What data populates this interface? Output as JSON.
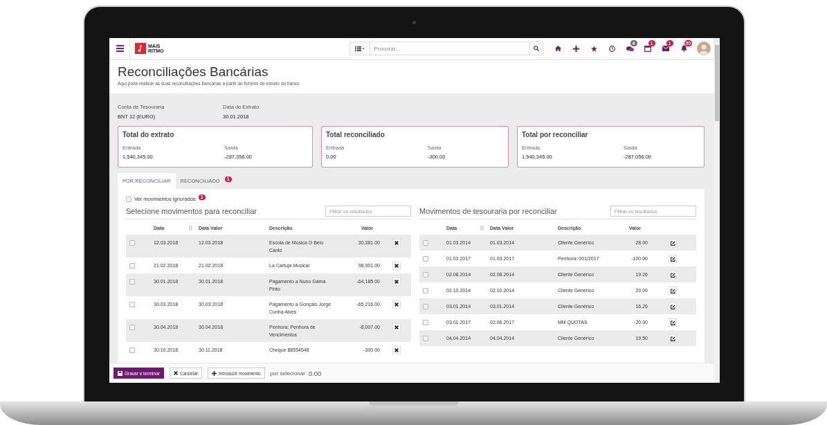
{
  "topbar": {
    "logo": {
      "line1": "MAIS",
      "line2": "RITMO"
    },
    "search": {
      "placeholder": "Procurar..."
    },
    "icons": [
      {
        "kind": "home"
      },
      {
        "kind": "plus"
      },
      {
        "kind": "star"
      },
      {
        "kind": "clock"
      },
      {
        "kind": "chat",
        "badge": "4",
        "color": "#6f6f6f"
      },
      {
        "kind": "calendar",
        "badge": "1",
        "color": "#e0173c"
      },
      {
        "kind": "envelope",
        "badge": "1",
        "color": "#e0173c"
      },
      {
        "kind": "bell",
        "badge": "50",
        "color": "#e0173c"
      }
    ]
  },
  "header": {
    "title": "Reconciliações Bancárias",
    "subtitle": "Aqui pode realizar as suas reconciliações bancárias a partir do ficheiro do extrato do banco"
  },
  "account": [
    {
      "label": "Conta de Tesouraria",
      "value": "BNT 12 (EURO)"
    },
    {
      "label": "Data do Extrato",
      "value": "30.01.2018"
    }
  ],
  "cards": [
    {
      "title": "Total do extrato",
      "in_label": "Entrada",
      "in_value": "1,540,345.00",
      "out_label": "Saída",
      "out_value": "-287,356.00"
    },
    {
      "title": "Total reconciliado",
      "in_label": "Entrada",
      "in_value": "0.00",
      "out_label": "Saída",
      "out_value": "-300.00"
    },
    {
      "title": "Total por reconciliar",
      "in_label": "Entrada",
      "in_value": "1,540,345.00",
      "out_label": "Saída",
      "out_value": "-287,056.00"
    }
  ],
  "tabs": [
    {
      "label": "POR RECONCILIAR",
      "selected": true
    },
    {
      "label": "RECONCILIADO",
      "selected": false,
      "badge": "1"
    }
  ],
  "ignored": {
    "label": "Ver movimentos ignorados",
    "checked": false,
    "badge": "1"
  },
  "tables": [
    {
      "title": "Selecione movimentos para reconciliar",
      "filter": {
        "placeholder": "Filtrar os resultados"
      },
      "kind": "ignore",
      "columns": [
        "Data",
        "Data Valor",
        "Descrição",
        "Valor"
      ],
      "rows": [
        {
          "date": "12.03.2018",
          "value_date": "12.03.2018",
          "description": "Escola de Música O Belo Canto",
          "amount": "30,381.00",
          "checked": false
        },
        {
          "date": "21.02.2018",
          "value_date": "21.02.2018",
          "description": "La Cartuja Musical",
          "amount": "98,901.00",
          "checked": false
        },
        {
          "date": "30.01.2018",
          "value_date": "30.01.2018",
          "description": "Pagamento a Nuno Gama Pinto",
          "amount": "-64,185.00",
          "checked": false
        },
        {
          "date": "30.03.2018",
          "value_date": "30.03.2018",
          "description": "Pagamento a Gonçalo Jorge Cunha Alves",
          "amount": "-65,216.00",
          "checked": false
        },
        {
          "date": "30.04.2018",
          "value_date": "30.04.2018",
          "description": "Penhora: Penhora de Vencimentos",
          "amount": "-8,007.00",
          "checked": false
        },
        {
          "date": "30.10.2018",
          "value_date": "30.11.2018",
          "description": "Cheque 88554548",
          "amount": "-300.00",
          "checked": false
        }
      ]
    },
    {
      "title": "Movimentos de tesouraria por reconciliar",
      "filter": {
        "placeholder": "Filtrar os resultados"
      },
      "kind": "edit",
      "columns": [
        "Data",
        "Data Valor",
        "Descrição",
        "Valor"
      ],
      "rows": [
        {
          "date": "01.03.2014",
          "value_date": "01.03.2014",
          "description": "Cliente Genérico",
          "amount": "28.00",
          "checked": false
        },
        {
          "date": "01.03.2017",
          "value_date": "01.03.2017",
          "description": "Penhora: 001/2017",
          "amount": "-100.00",
          "checked": false
        },
        {
          "date": "02.08.2014",
          "value_date": "02.08.2014",
          "description": "Cliente Genérico",
          "amount": "19.26",
          "checked": false
        },
        {
          "date": "02.10.2014",
          "value_date": "02.10.2014",
          "description": "Cliente Genérico",
          "amount": "29.00",
          "checked": false
        },
        {
          "date": "03.01.2014",
          "value_date": "03.01.2014",
          "description": "Cliente Genérico",
          "amount": "16.26",
          "checked": false
        },
        {
          "date": "03.01.2017",
          "value_date": "02.06.2017",
          "description": "MM QUOTAS",
          "amount": "-20.00",
          "checked": false
        },
        {
          "date": "04.04.2014",
          "value_date": "04.04.2014",
          "description": "Cliente Genérico",
          "amount": "19.50",
          "checked": false
        }
      ]
    }
  ],
  "footer": {
    "buttons": [
      {
        "kind": "save",
        "label": "Gravar e terminar"
      },
      {
        "kind": "cancel",
        "label": "Cancelar"
      },
      {
        "kind": "add",
        "label": "Introduzir movimento"
      }
    ],
    "selection_label": "por selecionar",
    "selection_value": "0.00"
  }
}
